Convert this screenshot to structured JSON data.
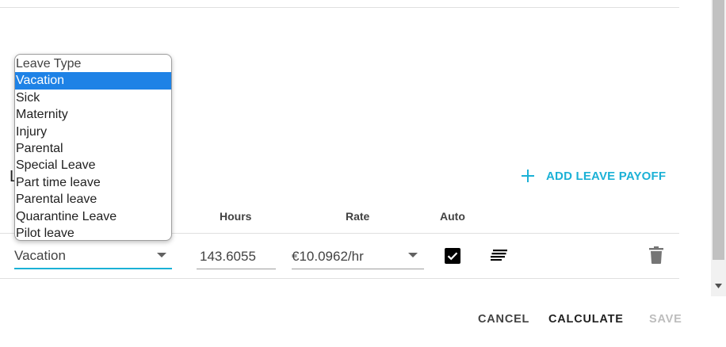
{
  "header": {
    "partial_heading_char": "L"
  },
  "add_leave_payoff": {
    "label": "ADD LEAVE PAYOFF"
  },
  "columns": {
    "hours": "Hours",
    "rate": "Rate",
    "auto": "Auto"
  },
  "row": {
    "leave_type": "Vacation",
    "hours": "143.6055",
    "rate": "€10.0962/hr",
    "auto_checked": true
  },
  "dropdown": {
    "options": [
      "Leave Type",
      "Vacation",
      "Sick",
      "Maternity",
      "Injury",
      "Parental",
      "Special Leave",
      "Part time leave",
      "Parental leave",
      "Quarantine Leave",
      "Pilot leave"
    ],
    "selected": "Vacation"
  },
  "footer": {
    "cancel": "CANCEL",
    "calculate": "CALCULATE",
    "save": "SAVE"
  },
  "colors": {
    "accent": "#1bb1d6",
    "highlight": "#1e82e6",
    "disabled": "#bdbdbd"
  }
}
